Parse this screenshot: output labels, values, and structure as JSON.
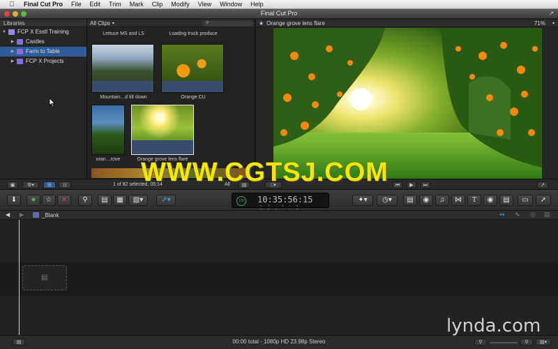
{
  "menubar": {
    "app_name": "Final Cut Pro",
    "items": [
      "File",
      "Edit",
      "Trim",
      "Mark",
      "Clip",
      "Modify",
      "View",
      "Window",
      "Help"
    ]
  },
  "window": {
    "title": "Final Cut Pro"
  },
  "library": {
    "header": "Libraries",
    "root": "FCP X Esstl Training",
    "events": [
      "Castles",
      "Farm to Table",
      "FCP X Projects"
    ],
    "selected": "Farm to Table"
  },
  "browser": {
    "filter": "All Clips",
    "clips": [
      {
        "label": "Lettuce MS and LS"
      },
      {
        "label": "Loading truck produce"
      },
      {
        "label": "Mountain…d tilt down"
      },
      {
        "label": "Orange CU"
      },
      {
        "label": "oran…rove"
      },
      {
        "label": "Orange grove lens flare"
      }
    ],
    "selection_status": "1 of 82 selected, 05:14",
    "all_label": "All"
  },
  "viewer": {
    "title": "Orange grove lens flare",
    "zoom": "71%"
  },
  "toolbar": {
    "timecode": "10:35:56:15",
    "timecode_badge": "100",
    "timecode_units": "HR MIN SEC FR"
  },
  "timeline": {
    "project_name": "_Blank"
  },
  "status": {
    "summary": "00:00 total - 1080p HD 23.98p Stereo"
  },
  "watermark": {
    "text": "WWW.CGTSJ.COM",
    "brand": "lynda.com"
  },
  "colors": {
    "accent": "#2f5d9a",
    "event": "#8a6fd6",
    "timecode_ring": "#3fa55a",
    "watermark": "#f4e60b"
  }
}
